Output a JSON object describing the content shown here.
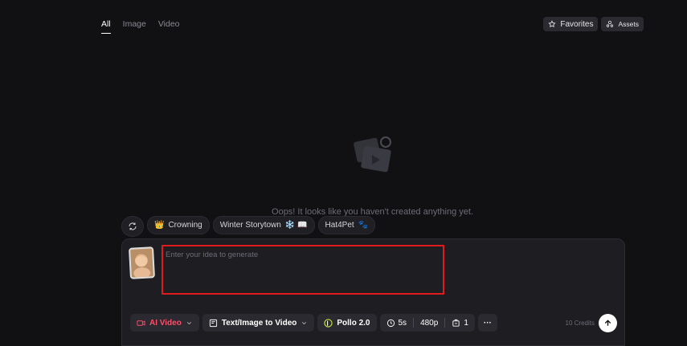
{
  "tabs": [
    {
      "label": "All"
    },
    {
      "label": "Image"
    },
    {
      "label": "Video"
    }
  ],
  "header": {
    "favorites_label": "Favorites",
    "assets_label": "Assets"
  },
  "empty_state": {
    "message": "Oops! It looks like you haven't created anything yet."
  },
  "suggestions": [
    {
      "label": "Crowning",
      "emoji": "👑"
    },
    {
      "label": "Winter Storytown",
      "emoji": "❄️ 📖"
    },
    {
      "label": "Hat4Pet",
      "emoji": "🐾"
    }
  ],
  "prompt": {
    "placeholder": "Enter your idea to generate",
    "value": ""
  },
  "toolbar": {
    "mode_label": "AI Video",
    "type_label": "Text/Image to Video",
    "model_label": "Pollo 2.0",
    "duration": "5s",
    "resolution": "480p",
    "count": "1",
    "more_label": "···"
  },
  "credits_label": "10 Credits",
  "colors": {
    "background": "#111114",
    "panel": "#1d1d22",
    "accent_red": "#ff4d6a",
    "highlight_border": "#e01b1b"
  }
}
